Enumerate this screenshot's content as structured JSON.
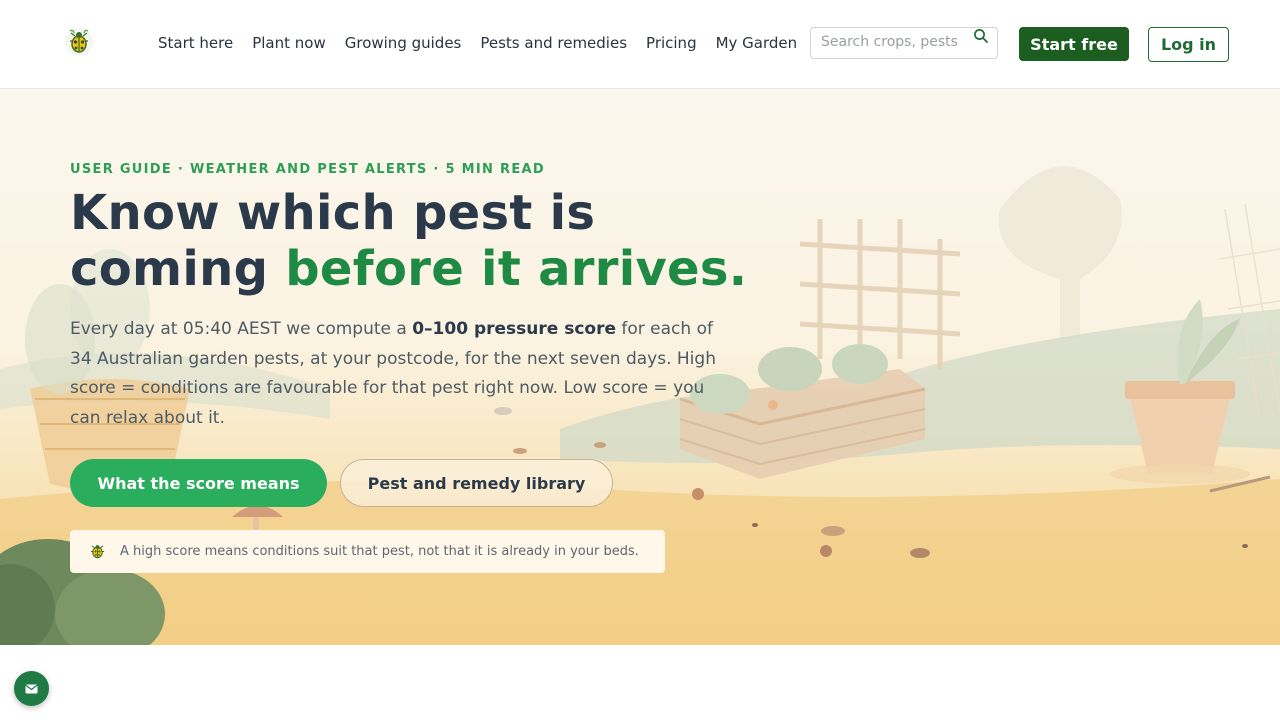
{
  "header": {
    "logo_icon": "beetle-logo-icon",
    "nav": [
      "Start here",
      "Plant now",
      "Growing guides",
      "Pests and remedies",
      "Pricing",
      "My Garden"
    ],
    "search": {
      "placeholder": "Search crops, pests",
      "icon": "search-icon"
    },
    "start_label": "Start free",
    "login_label": "Log in"
  },
  "hero": {
    "eyebrow": "USER GUIDE · WEATHER AND PEST ALERTS · 5 MIN READ",
    "headline_part1": "Know which pest is coming ",
    "headline_accent": "before it arrives.",
    "lead_pre": "Every day at 05:40 AEST we compute a ",
    "lead_bold": "0–100 pressure score",
    "lead_post": " for each of 34 Australian garden pests, at your postcode, for the next seven days. High score = conditions are favourable for that pest right now. Low score = you can relax about it.",
    "primary_cta": "What the score means",
    "secondary_cta": "Pest and remedy library",
    "note_icon": "beetle-icon",
    "note": "A high score means conditions suit that pest, not that it is already in your beds."
  },
  "chat": {
    "icon": "mail-icon"
  },
  "colors": {
    "brand_dark": "#1b5e20",
    "brand_green": "#2bad5e",
    "accent_text": "#1f8a43",
    "heading": "#2b3a4a"
  }
}
